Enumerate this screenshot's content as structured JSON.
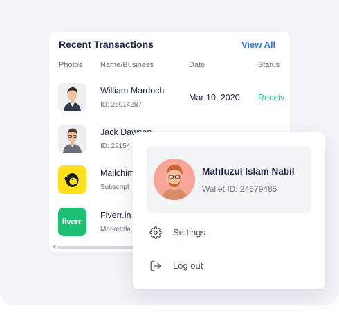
{
  "transactions": {
    "title": "Recent Transactions",
    "view_all": "View All",
    "columns": [
      "Photos",
      "Name/Business",
      "Date",
      "Status"
    ],
    "rows": [
      {
        "name": "William Mardoch",
        "sub": "ID: 25014287",
        "date": "Mar 10, 2020",
        "status": "Receiv",
        "photo": "person-avatar"
      },
      {
        "name": "Jack Dawson",
        "sub": "ID: 22154",
        "date": "",
        "status": "",
        "photo": "person-avatar"
      },
      {
        "name": "Mailchim",
        "sub": "Subscript",
        "date": "",
        "status": "",
        "photo": "mailchimp-logo"
      },
      {
        "name": "Fiverr.in",
        "sub": "Marketpla",
        "date": "",
        "status": "",
        "photo": "fiverr-logo",
        "logo_text": "fiverr."
      }
    ]
  },
  "profile_menu": {
    "name": "Mahfuzul Islam Nabil",
    "wallet": "Wallet ID: 24579485",
    "items": [
      {
        "label": "Settings",
        "icon": "gear-icon"
      },
      {
        "label": "Log out",
        "icon": "logout-icon"
      }
    ]
  },
  "colors": {
    "accent_blue": "#2f72e8",
    "status_green": "#2cc38a",
    "mailchimp_yellow": "#ffe01b",
    "fiverr_green": "#1dbf73",
    "heading": "#1c2548"
  }
}
